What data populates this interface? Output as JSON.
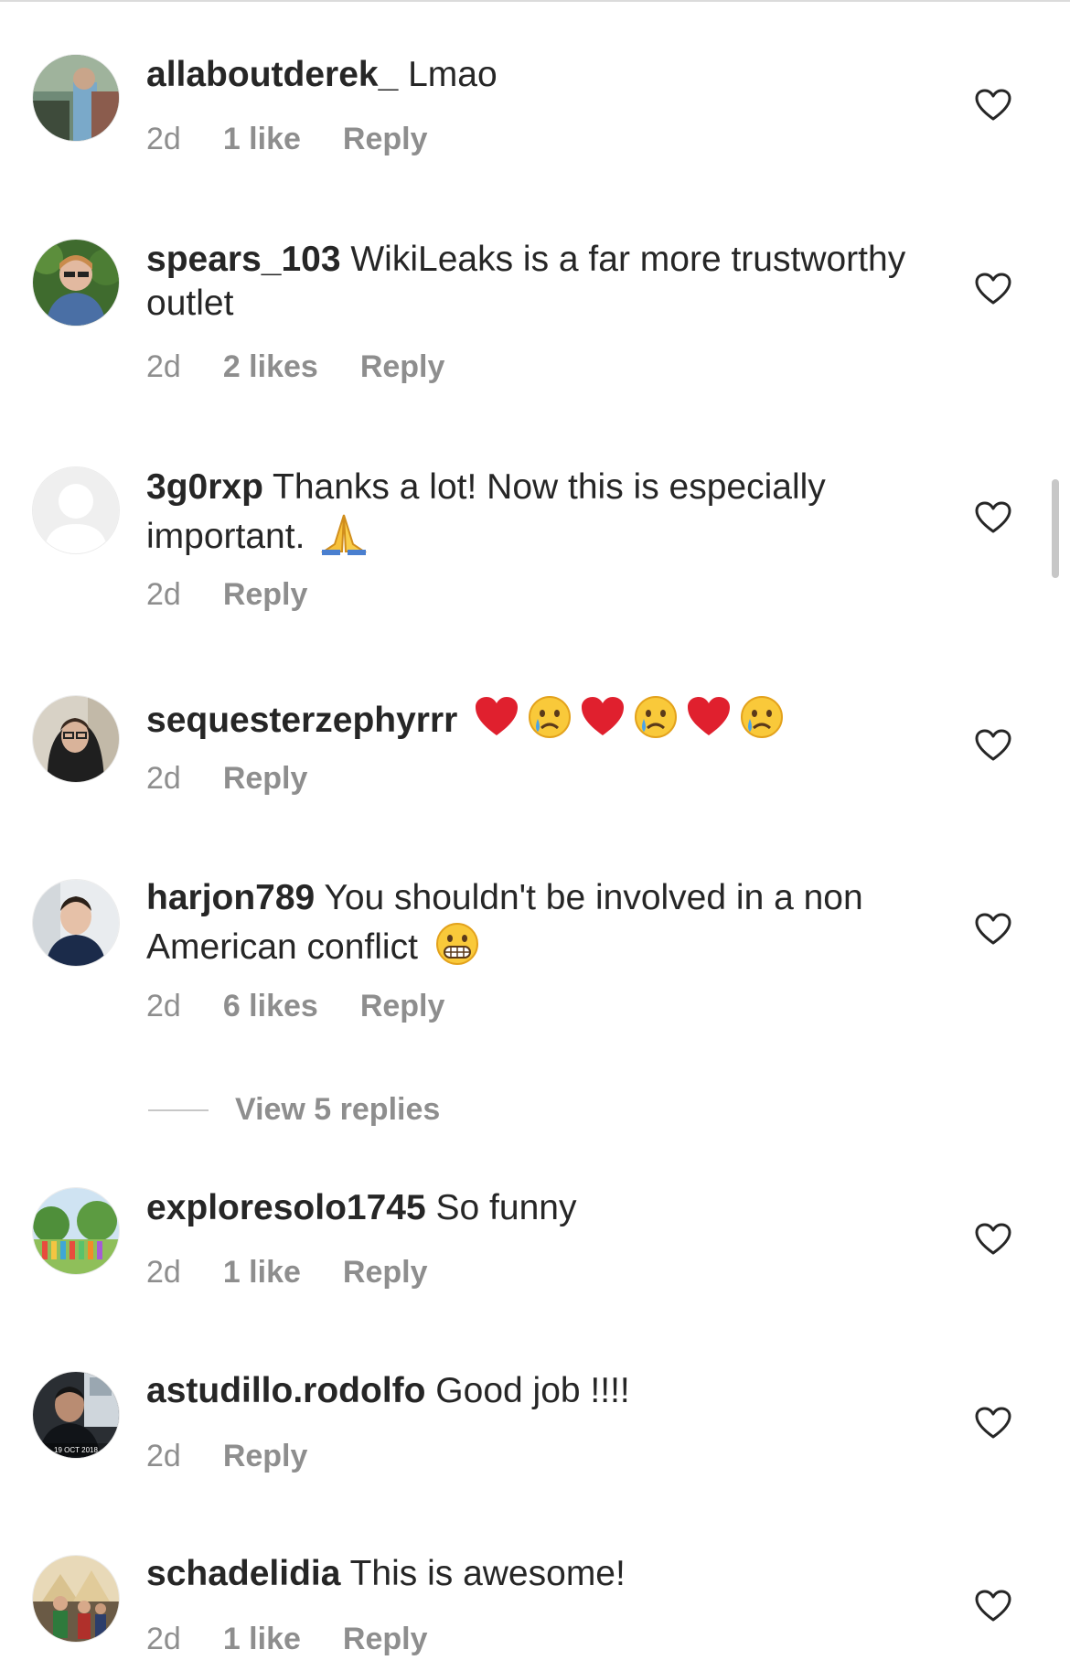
{
  "comments": [
    {
      "username": "allaboutderek_",
      "text": " Lmao",
      "time": "2d",
      "likes": "1 like",
      "reply": "Reply"
    },
    {
      "username": "spears_103",
      "text": " WikiLeaks is a far more trustworthy outlet",
      "time": "2d",
      "likes": "2 likes",
      "reply": "Reply"
    },
    {
      "username": "3g0rxp",
      "text": " Thanks a lot! Now this is especially important. ",
      "emoji": [
        "folded-hands"
      ],
      "time": "2d",
      "reply": "Reply"
    },
    {
      "username": "sequesterzephyrrr",
      "text": " ",
      "emoji": [
        "red-heart",
        "crying-face",
        "red-heart",
        "crying-face",
        "red-heart",
        "crying-face"
      ],
      "time": "2d",
      "reply": "Reply"
    },
    {
      "username": "harjon789",
      "text": " You shouldn't be involved in a non American conflict ",
      "emoji": [
        "grimacing-face"
      ],
      "time": "2d",
      "likes": "6 likes",
      "reply": "Reply"
    },
    {
      "username": "exploresolo1745",
      "text": " So funny",
      "time": "2d",
      "likes": "1 like",
      "reply": "Reply"
    },
    {
      "username": "astudillo.rodolfo",
      "text": " Good job !!!!",
      "time": "2d",
      "reply": "Reply"
    },
    {
      "username": "schadelidia",
      "text": " This is awesome!",
      "time": "2d",
      "likes": "1 like",
      "reply": "Reply"
    }
  ],
  "view_replies": "View 5 replies",
  "avatar_watermark": "19 OCT 2018",
  "colors": {
    "text": "#262626",
    "secondary": "#8e8e8e",
    "divider": "#dbdbdb"
  },
  "icons": {
    "like": "heart-outline-icon"
  }
}
